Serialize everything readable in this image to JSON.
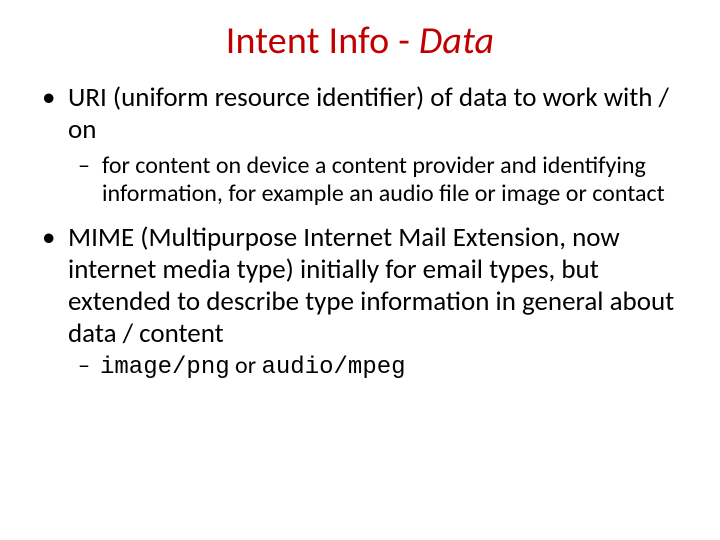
{
  "title": {
    "prefix": "Intent Info - ",
    "emphatic": "Data"
  },
  "bullets": {
    "uri": {
      "text": "URI (uniform resource identifier) of data to work with / on",
      "sub": "for content on device a content provider and identifying information, for example an audio file or image or contact"
    },
    "mime": {
      "text": "MIME (Multipurpose Internet Mail Extension, now internet media type) initially for email types, but extended to describe type information in general about data / content",
      "sub_code1": "image/png",
      "sub_join": " or ",
      "sub_code2": "audio/mpeg"
    }
  }
}
